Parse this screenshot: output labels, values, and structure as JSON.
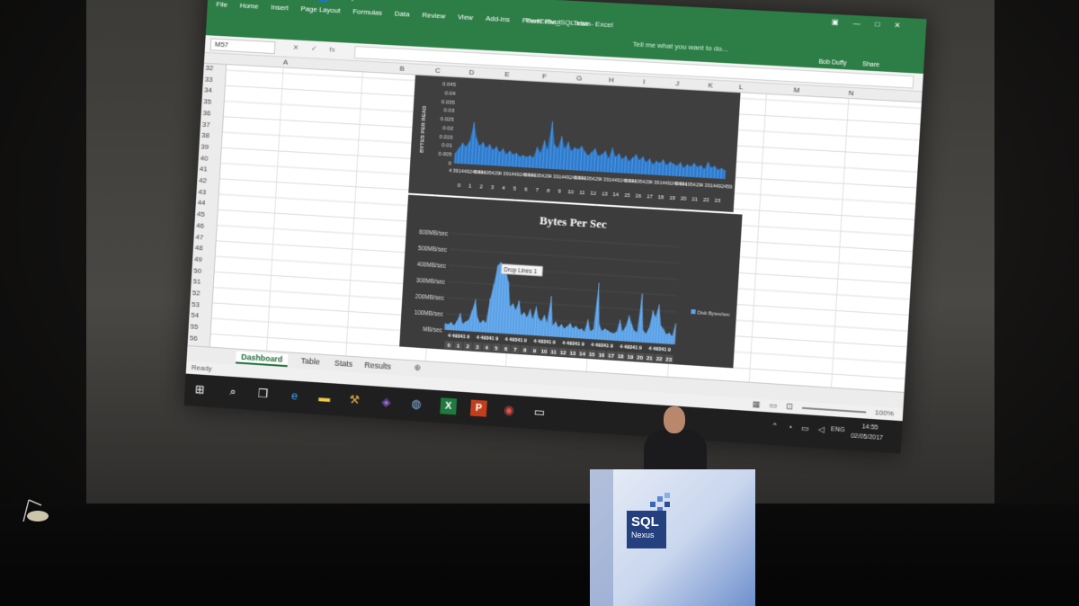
{
  "excel": {
    "quick_access": [
      "↶",
      "↷",
      "👤",
      "▾"
    ],
    "title": "PerfCube_SQL.xlsx - Excel",
    "tabs": [
      "File",
      "Home",
      "Insert",
      "Page Layout",
      "Formulas",
      "Data",
      "Review",
      "View",
      "Add-ins",
      "Power Pivot",
      "Team"
    ],
    "tell_me": "Tell me what you want to do...",
    "user": "Bob Duffy",
    "share": "Share",
    "name_box": "M57",
    "fx_icons": [
      "✕",
      "✓",
      "fx"
    ],
    "window_buttons": [
      "▣",
      "—",
      "□",
      "✕"
    ],
    "columns": [
      "A",
      "B",
      "C",
      "D",
      "E",
      "F",
      "G",
      "H",
      "I",
      "J",
      "K",
      "L",
      "M",
      "N"
    ],
    "rows": [
      "32",
      "33",
      "34",
      "35",
      "36",
      "37",
      "38",
      "39",
      "40",
      "41",
      "42",
      "43",
      "44",
      "45",
      "46",
      "47",
      "48",
      "49",
      "50",
      "51",
      "52",
      "53",
      "54",
      "55",
      "56"
    ],
    "sheet_tabs": [
      "Dashboard",
      "Table",
      "Stats",
      "Results"
    ],
    "active_sheet": "Dashboard",
    "add_sheet": "⊕",
    "status": "Ready",
    "view_icons": [
      "▦",
      "▭",
      "⊡"
    ],
    "zoom": "100%",
    "zoom_minus": "-",
    "zoom_plus": "+"
  },
  "chart_data": [
    {
      "type": "area",
      "title": "",
      "ylabel": "BYTES PER READ",
      "ylim": [
        0,
        0.045
      ],
      "yticks": [
        "0.045",
        "0.04",
        "0.035",
        "0.03",
        "0.025",
        "0.02",
        "0.015",
        "0.01",
        "0.005",
        "0"
      ],
      "x_label_row1": "4 391449245934 9 44195429 4 391449245934 9 44195429 4 391449245934 9 44195429 4 391449245934 9 44195429 4 391449245934 9 44195429 4 391449245934 9 44195429 4 391449245934 9 44195429 4 391449245934 9 44195429 4 391449245934 9 44195429 4 391449245934 9 44195429 4 391449245934 9 44195429 4 391449245934 9 44195429 4 391449245934 9 44195429",
      "x_label_row1_short": [
        "4 391449245934",
        "9 44195429",
        "4 391449245934",
        "9 44195429",
        "4 391449245934",
        "9 44195429",
        "4 391449245934",
        "9 44195429",
        "4 391449245934",
        "9 44195429",
        "4 3914492459"
      ],
      "hours": [
        "0",
        "1",
        "2",
        "3",
        "4",
        "5",
        "6",
        "7",
        "8",
        "9",
        "10",
        "11",
        "12",
        "13",
        "14",
        "15",
        "16",
        "17",
        "18",
        "19",
        "20",
        "21",
        "22",
        "23"
      ],
      "color": "#2f7fd6",
      "values": [
        0.006,
        0.009,
        0.012,
        0.01,
        0.013,
        0.024,
        0.015,
        0.011,
        0.013,
        0.01,
        0.012,
        0.009,
        0.011,
        0.008,
        0.01,
        0.007,
        0.009,
        0.007,
        0.008,
        0.006,
        0.007,
        0.006,
        0.007,
        0.006,
        0.012,
        0.009,
        0.016,
        0.011,
        0.027,
        0.014,
        0.012,
        0.019,
        0.012,
        0.016,
        0.011,
        0.013,
        0.012,
        0.014,
        0.011,
        0.009,
        0.011,
        0.013,
        0.009,
        0.01,
        0.012,
        0.008,
        0.014,
        0.009,
        0.011,
        0.008,
        0.01,
        0.007,
        0.009,
        0.011,
        0.008,
        0.01,
        0.007,
        0.009,
        0.006,
        0.008,
        0.007,
        0.009,
        0.006,
        0.008,
        0.007,
        0.006,
        0.008,
        0.005,
        0.007,
        0.006,
        0.008,
        0.006,
        0.007,
        0.005,
        0.009,
        0.006,
        0.007,
        0.005,
        0.006,
        0.005
      ]
    },
    {
      "type": "area",
      "title": "Bytes Per Sec",
      "ylim": [
        0,
        600
      ],
      "yticks": [
        "600MB/sec",
        "500MB/sec",
        "400MB/sec",
        "300MB/sec",
        "200MB/sec",
        "100MB/sec",
        "MB/sec"
      ],
      "legend": "Disk Bytes/sec",
      "legend_position": "right",
      "tooltip": "Drop Lines 1",
      "x_labels_row1": [
        "4",
        "49341",
        "9",
        "4",
        "49341",
        "9",
        "4",
        "49341",
        "9",
        "4",
        "49341",
        "9",
        "4",
        "49341",
        "9",
        "4",
        "49341",
        "9",
        "4",
        "49341",
        "9",
        "4",
        "49341",
        "9"
      ],
      "hours": [
        "0",
        "1",
        "2",
        "3",
        "4",
        "5",
        "6",
        "7",
        "8",
        "9",
        "10",
        "11",
        "12",
        "13",
        "14",
        "15",
        "16",
        "17",
        "18",
        "19",
        "20",
        "21",
        "22",
        "23"
      ],
      "color": "#5aa4ee",
      "values": [
        40,
        35,
        50,
        30,
        60,
        110,
        45,
        60,
        70,
        130,
        200,
        90,
        55,
        75,
        60,
        210,
        300,
        420,
        440,
        400,
        380,
        320,
        170,
        190,
        150,
        210,
        120,
        140,
        110,
        160,
        100,
        180,
        110,
        90,
        130,
        85,
        250,
        70,
        95,
        60,
        80,
        55,
        70,
        90,
        60,
        75,
        55,
        60,
        45,
        120,
        50,
        60,
        350,
        90,
        55,
        70,
        60,
        50,
        45,
        55,
        130,
        60,
        90,
        160,
        110,
        70,
        60,
        300,
        75,
        55,
        90,
        200,
        160,
        240,
        110,
        90,
        60,
        70,
        50,
        130
      ]
    }
  ],
  "taskbar": {
    "icons": [
      "⊞",
      "⌕",
      "❐",
      "e",
      "▬",
      "⚒",
      "◈",
      "◍",
      "X",
      "P",
      "◉",
      "▭"
    ],
    "tray": [
      "⌃",
      "◔",
      "▭",
      "◁"
    ],
    "lang": "ENG",
    "time": "14:55",
    "date": "02/05/2017"
  },
  "podium": {
    "logo_line1": "SQL",
    "logo_line2": "Nexus"
  }
}
